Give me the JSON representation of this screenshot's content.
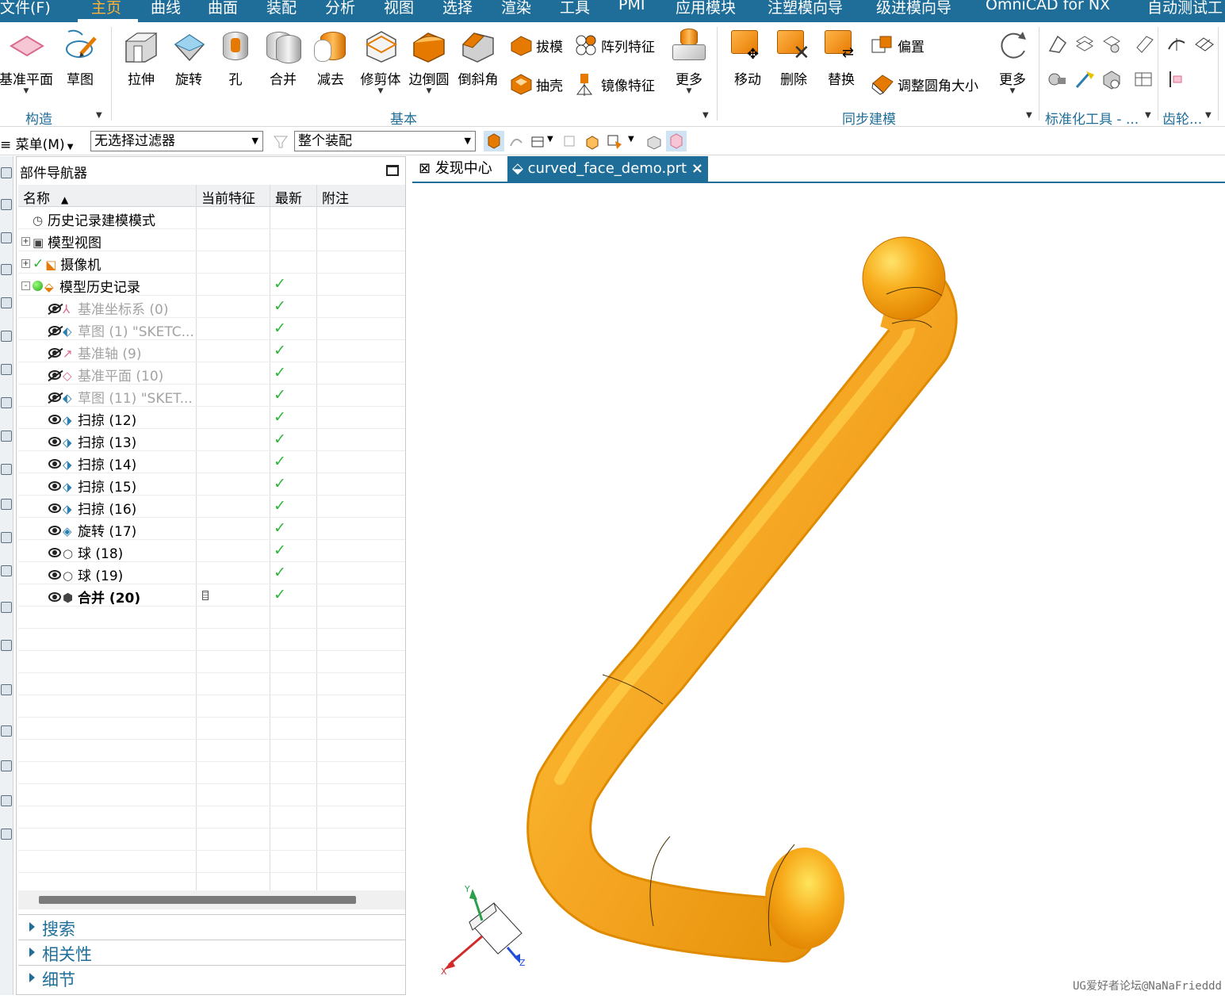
{
  "menubar": {
    "items": [
      "文件(F)",
      "主页",
      "曲线",
      "曲面",
      "装配",
      "分析",
      "视图",
      "选择",
      "渲染",
      "工具",
      "PMI",
      "应用模块",
      "注塑模向导",
      "级进模向导",
      "OmniCAD for NX",
      "自动测试工"
    ],
    "active_index": 1
  },
  "ribbon": {
    "construct": {
      "datum_plane": "基准平面",
      "sketch": "草图",
      "group": "构造"
    },
    "basic": {
      "extrude": "拉伸",
      "revolve": "旋转",
      "hole": "孔",
      "unite": "合并",
      "subtract": "减去",
      "trim_body": "修剪体",
      "edge_blend": "边倒圆",
      "chamfer": "倒斜角",
      "draft": "拔模",
      "pattern_feature": "阵列特征",
      "shell": "抽壳",
      "mirror_feature": "镜像特征",
      "more": "更多",
      "group": "基本"
    },
    "sync": {
      "move": "移动",
      "delete": "删除",
      "replace": "替换",
      "offset": "偏置",
      "resize_blend": "调整圆角大小",
      "more": "更多",
      "group": "同步建模"
    },
    "std_tools_group": "标准化工具 - ...",
    "gear_group": "齿轮..."
  },
  "selbar": {
    "menu": "菜单(M)",
    "filter": "无选择过滤器",
    "scope": "整个装配"
  },
  "navigator": {
    "title": "部件导航器",
    "columns": {
      "name": "名称",
      "current": "当前特征",
      "latest": "最新",
      "note": "附注"
    },
    "rows": [
      {
        "name": "历史记录建模模式",
        "level": 0,
        "icon": "clock-icon",
        "expander": "",
        "eye": "",
        "dim": false,
        "bold": false,
        "check": false
      },
      {
        "name": "模型视图",
        "level": 0,
        "icon": "model-view-icon",
        "expander": "+",
        "eye": "",
        "dim": false,
        "bold": false,
        "check": false
      },
      {
        "name": "摄像机",
        "level": 0,
        "icon": "camera-icon",
        "expander": "+",
        "eye": "",
        "dim": false,
        "bold": false,
        "check": false,
        "precheck": true
      },
      {
        "name": "模型历史记录",
        "level": 0,
        "icon": "model-history-icon",
        "expander": "-",
        "eye": "",
        "dim": false,
        "bold": false,
        "check": true,
        "greendot": true
      },
      {
        "name": "基准坐标系 (0)",
        "level": 1,
        "icon": "datum-csys-icon",
        "expander": "",
        "eye": "off",
        "dim": true,
        "bold": false,
        "check": true
      },
      {
        "name": "草图 (1) \"SKETC...",
        "level": 1,
        "icon": "sketch-icon",
        "expander": "",
        "eye": "off",
        "dim": true,
        "bold": false,
        "check": true
      },
      {
        "name": "基准轴 (9)",
        "level": 1,
        "icon": "datum-axis-icon",
        "expander": "",
        "eye": "off",
        "dim": true,
        "bold": false,
        "check": true
      },
      {
        "name": "基准平面 (10)",
        "level": 1,
        "icon": "datum-plane-icon",
        "expander": "",
        "eye": "off",
        "dim": true,
        "bold": false,
        "check": true
      },
      {
        "name": "草图 (11) \"SKET...",
        "level": 1,
        "icon": "sketch-icon",
        "expander": "",
        "eye": "off",
        "dim": true,
        "bold": false,
        "check": true
      },
      {
        "name": "扫掠 (12)",
        "level": 1,
        "icon": "sweep-icon",
        "expander": "",
        "eye": "on",
        "dim": false,
        "bold": false,
        "check": true
      },
      {
        "name": "扫掠 (13)",
        "level": 1,
        "icon": "sweep-icon",
        "expander": "",
        "eye": "on",
        "dim": false,
        "bold": false,
        "check": true
      },
      {
        "name": "扫掠 (14)",
        "level": 1,
        "icon": "sweep-icon",
        "expander": "",
        "eye": "on",
        "dim": false,
        "bold": false,
        "check": true
      },
      {
        "name": "扫掠 (15)",
        "level": 1,
        "icon": "sweep-icon",
        "expander": "",
        "eye": "on",
        "dim": false,
        "bold": false,
        "check": true
      },
      {
        "name": "扫掠 (16)",
        "level": 1,
        "icon": "sweep-icon",
        "expander": "",
        "eye": "on",
        "dim": false,
        "bold": false,
        "check": true
      },
      {
        "name": "旋转 (17)",
        "level": 1,
        "icon": "revolve-icon",
        "expander": "",
        "eye": "on",
        "dim": false,
        "bold": false,
        "check": true
      },
      {
        "name": "球 (18)",
        "level": 1,
        "icon": "sphere-icon",
        "expander": "",
        "eye": "on",
        "dim": false,
        "bold": false,
        "check": true
      },
      {
        "name": "球 (19)",
        "level": 1,
        "icon": "sphere-icon",
        "expander": "",
        "eye": "on",
        "dim": false,
        "bold": false,
        "check": true
      },
      {
        "name": "合并 (20)",
        "level": 1,
        "icon": "unite-icon",
        "expander": "",
        "eye": "on",
        "dim": false,
        "bold": true,
        "check": true,
        "current": true
      }
    ],
    "sections": [
      "搜索",
      "相关性",
      "细节"
    ]
  },
  "tabs": {
    "discovery": "发现中心",
    "file": "curved_face_demo.prt",
    "close": "×"
  },
  "triad": {
    "x": "X",
    "y": "Y",
    "z": "Z"
  },
  "watermark": "UG爱好者论坛@NaNaFrieddd",
  "colors": {
    "accent": "#1f6e99",
    "model": "#f5a623",
    "check": "#2fb53a",
    "menu_active": "#ffb238"
  }
}
